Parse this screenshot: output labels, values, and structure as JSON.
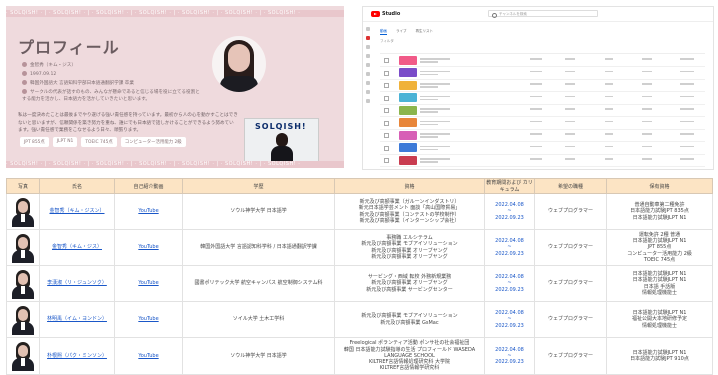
{
  "profile": {
    "deco_text": "· SOLQISH! · | · SOLQISH! · | · SOLQISH! · | · SOLQISH! · | · SOLQISH! · | · SOLQISH! · | · SOLQISH! ·",
    "title": "プロフィール",
    "info": [
      "金智秀（キム・ジス）",
      "1997.09.12",
      "韓国外国語大 言語知科学部日本語通翻訳学課 卒業"
    ],
    "bullets": "サークルの代表が話すのもの、みんなが懸命であると信じる場を役に立てる役割とする能力を活かし、日本語力を活かしていきたいと思います。",
    "para": "私は一度決めたことは最後までやり遂げる強い責任感を持っています。最初から人の心を動かすことはできないと思いますが、信頼関係を築き努力を重ね、誰にでも日本語で話しかけることができるよう努めています。強い責任感で業務をこなせるよう日々、頑張ります。",
    "tags": [
      "JPT 855点",
      "JLPT N1",
      "TOEIC 745点",
      "コンピューター活用能力 2級"
    ],
    "cam_sign": "SOLQISH!"
  },
  "studio": {
    "brand": "Studio",
    "search_placeholder": "チャンネルを検索",
    "tabs": [
      "動画",
      "ライブ",
      "再生リスト"
    ],
    "filter": "フィルタ",
    "thumb_colors": [
      "#f15a88",
      "#7a4cc9",
      "#f0b23a",
      "#4bb3d6",
      "#8bb54c",
      "#e8863a",
      "#d75fb6",
      "#3d7ad8",
      "#c93c50"
    ]
  },
  "table": {
    "headers": [
      "写真",
      "氏名",
      "自己紹介動画",
      "学歴",
      "資格",
      "教育期間および カリキュラム",
      "希望の職種",
      "保有資格"
    ],
    "rows": [
      {
        "name": "金智秀（キム・ジスン）",
        "video": "YouTube",
        "school": "ソウル神学大学 日本語学",
        "licenses": [
          "新元及び高額事業（ガルーンインダストリ）",
          "新元日本語学芸メント 面談「高山国際貿易」",
          "新元及び高額事業（コンテストの学校制作）",
          "新元及び高額事業（インターンシップ会社）"
        ],
        "period": [
          "2022.04.08",
          "~",
          "2022.09.23"
        ],
        "job": "ウェブプログラマー",
        "quals": [
          "普通自動車第二種免許",
          "日本語能力試験JPT 835点",
          "日本語能力試験JLPT N1"
        ]
      },
      {
        "name": "金智秀（キム・ジス）",
        "video": "YouTube",
        "school": "韓国外国語大学 言語認知科学科 / 日本語通翻訳学課",
        "licenses": [
          "事務職 エルシテラム",
          "新元及び高額事業 モブアイソリューション",
          "新元及び高額事業 オリーブヤング",
          "新元及び高額事業 オリーブヤング"
        ],
        "period": [
          "2022.04.08",
          "~",
          "2022.09.23"
        ],
        "job": "ウェブプログラマー",
        "quals": [
          "運転免許 2種 普通",
          "日本語能力試験JLPT N1",
          "JPT 855点",
          "コンピューター活用能力 2級",
          "TOEIC 745点"
        ]
      },
      {
        "name": "李漢淑（リ・ジュンソク）",
        "video": "YouTube",
        "school": "國書ポリテック大学 航空キャンパス 航空制御システム科",
        "licenses": [
          "サービング・西域 転校 外務新規業務",
          "新元及び高額事業 オリーブヤング",
          "新元及び高額事業 サービングセンター"
        ],
        "period": [
          "2022.04.08",
          "~",
          "2022.09.23"
        ],
        "job": "ウェブプログラマー",
        "quals": [
          "日本語能力試験JLPT N1",
          "日本語能力試験JLPT N1",
          "日本語 手話版",
          "情報処理機能士"
        ]
      },
      {
        "name": "林明禹（イム・ヨンドン）",
        "video": "YouTube",
        "school": "ソイル大学 土木工学科",
        "licenses": [
          "新元及び高額事業 モブアイソリューション",
          "新元及び高額事業 GsMac"
        ],
        "period": [
          "2022.04.08",
          "~",
          "2022.09.23"
        ],
        "job": "ウェブプログラマー",
        "quals": [
          "日本語能力試験JLPT N1",
          "福祉公開大本地研修予定",
          "情報処理機能士"
        ]
      },
      {
        "name": "朴根熙（パク・ミンソン）",
        "video": "YouTube",
        "school": "ソウル神学大学 日本語学",
        "licenses": [
          "Freelogical ポランティア活動 ポンサ社の社会福祉団",
          "韓国 日本語能力試験指導の生活 プロフィールド WASEDA LANGUAGE SCHOOL",
          "KILTREF言語情報処理研究科 大学院",
          "KILTREF言語情報学研究科"
        ],
        "period": [
          "2022.04.08",
          "~",
          "2022.09.23"
        ],
        "job": "ウェブプログラマー",
        "quals": [
          "日本語能力試験JLPT N1",
          "日本語能力試験JPT 910点"
        ]
      }
    ]
  }
}
